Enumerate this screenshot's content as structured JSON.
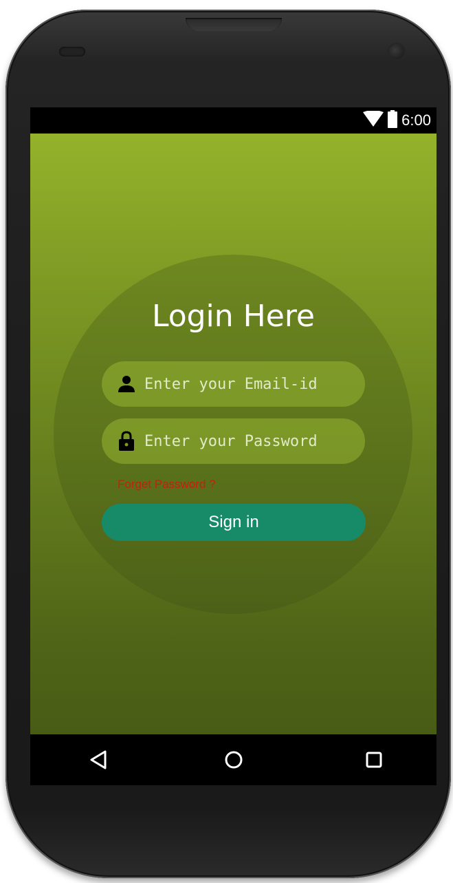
{
  "status_bar": {
    "time": "6:00",
    "wifi_icon": "wifi-icon",
    "battery_icon": "battery-icon"
  },
  "login": {
    "title": "Login Here",
    "email": {
      "placeholder": "Enter your Email-id",
      "value": "",
      "icon": "person-icon"
    },
    "password": {
      "placeholder": "Enter your Password",
      "value": "",
      "icon": "lock-icon"
    },
    "forgot_label": "Forget Password ?",
    "signin_label": "Sign in"
  },
  "nav_bar": {
    "back_icon": "back-triangle-icon",
    "home_icon": "home-circle-icon",
    "recents_icon": "recents-square-icon"
  },
  "colors": {
    "gradient_top": "#95b22b",
    "gradient_bottom": "#485c16",
    "button": "#178a68",
    "forgot_text": "#c81e0a",
    "status_bar": "#000000"
  }
}
